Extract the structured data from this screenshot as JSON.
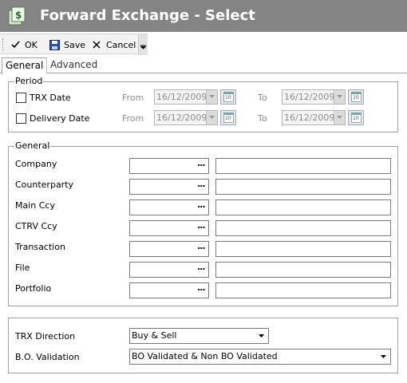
{
  "window": {
    "title": "Forward Exchange - Select"
  },
  "toolbar": {
    "ok_label": "OK",
    "save_label": "Save",
    "cancel_label": "Cancel"
  },
  "tabs": [
    {
      "label": "General"
    },
    {
      "label": "Advanced"
    }
  ],
  "period": {
    "legend": "Period",
    "from_label": "From",
    "to_label": "To",
    "rows": [
      {
        "label": "TRX Date",
        "checked": false,
        "from": "16/12/2009",
        "to": "16/12/2009"
      },
      {
        "label": "Delivery Date",
        "checked": false,
        "from": "16/12/2009",
        "to": "16/12/2009"
      }
    ],
    "calendar_icon_text": "10"
  },
  "general": {
    "legend": "General",
    "fields": [
      {
        "label": "Company",
        "code": "",
        "description": ""
      },
      {
        "label": "Counterparty",
        "code": "",
        "description": ""
      },
      {
        "label": "Main Ccy",
        "code": "",
        "description": ""
      },
      {
        "label": "CTRV Ccy",
        "code": "",
        "description": ""
      },
      {
        "label": "Transaction",
        "code": "",
        "description": ""
      },
      {
        "label": "File",
        "code": "",
        "description": ""
      },
      {
        "label": "Portfolio",
        "code": "",
        "description": ""
      }
    ],
    "lookup_button_text": "..."
  },
  "filters": {
    "trx_direction": {
      "label": "TRX Direction",
      "value": "Buy & Sell"
    },
    "bo_validation": {
      "label": "B.O. Validation",
      "value": "BO Validated & Non BO Validated"
    }
  },
  "colors": {
    "titlebar": "#848484",
    "title_text": "#ffffff",
    "cancel_red": "#cc0000",
    "save_blue": "#2b4fa8"
  },
  "icons": {
    "app": "forward-exchange-app-icon",
    "ok": "checkmark-icon",
    "save": "floppy-disk-icon",
    "cancel": "x-icon",
    "calendar": "calendar-icon"
  }
}
